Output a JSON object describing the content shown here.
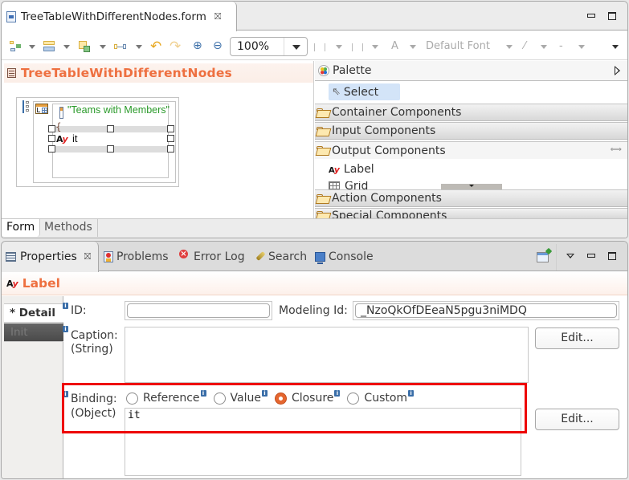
{
  "editor": {
    "tab_title": "TreeTableWithDifferentNodes.form",
    "toolbar": {
      "zoom_value": "100%",
      "font_label": "Default Font",
      "font_color_label": "A",
      "line_style_label": "-"
    },
    "form_title": "TreeTableWithDifferentNodes",
    "canvas": {
      "table_caption": "\"Teams with Members\"",
      "node_brace": "{",
      "label_text": "it"
    },
    "page_tabs": [
      {
        "label": "Form",
        "active": true
      },
      {
        "label": "Methods",
        "active": false
      }
    ]
  },
  "palette": {
    "title": "Palette",
    "select_tool": "Select",
    "drawers": [
      {
        "label": "Container Components",
        "open": false
      },
      {
        "label": "Input Components",
        "open": false
      },
      {
        "label": "Output Components",
        "open": true
      },
      {
        "label": "Action Components",
        "open": false
      },
      {
        "label": "Special Components",
        "open": false
      }
    ],
    "output_items": [
      "Label",
      "Grid"
    ]
  },
  "properties": {
    "tabs": [
      {
        "label": "Properties",
        "active": true,
        "icon": "properties-icon"
      },
      {
        "label": "Problems",
        "active": false,
        "icon": "problems-icon"
      },
      {
        "label": "Error Log",
        "active": false,
        "icon": "error-log-icon"
      },
      {
        "label": "Search",
        "active": false,
        "icon": "search-icon"
      },
      {
        "label": "Console",
        "active": false,
        "icon": "console-icon"
      }
    ],
    "element_title": "Label",
    "section_tabs": [
      {
        "label": "* Detail",
        "active": true
      },
      {
        "label": "Init",
        "active": false
      }
    ],
    "fields": {
      "id_label": "ID:",
      "id_value": "",
      "modeling_id_label": "Modeling Id:",
      "modeling_id_value": "_NzoQkOfDEeaN5pgu3niMDQ",
      "caption_label": "Caption:",
      "caption_type": "(String)",
      "caption_value": "",
      "caption_edit": "Edit...",
      "binding_label": "Binding:",
      "binding_type": "(Object)",
      "binding_options": [
        {
          "label": "Reference",
          "checked": false
        },
        {
          "label": "Value",
          "checked": false
        },
        {
          "label": "Closure",
          "checked": true
        },
        {
          "label": "Custom",
          "checked": false
        }
      ],
      "binding_value": "it",
      "binding_edit": "Edit..."
    },
    "info_glyph": "i",
    "highlight_color": "#ee0000",
    "accent_color": "#ee7040"
  }
}
